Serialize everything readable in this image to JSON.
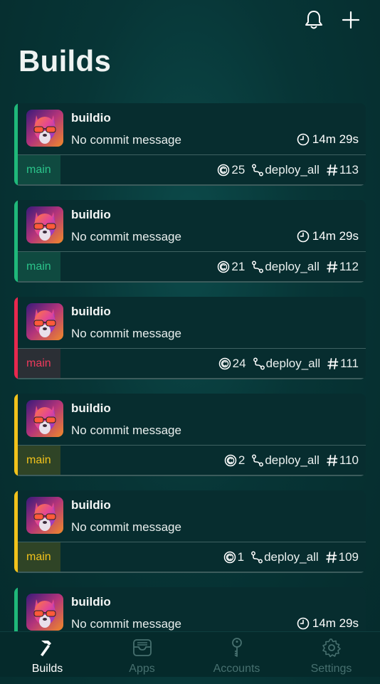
{
  "header": {
    "title": "Builds"
  },
  "builds": [
    {
      "repo": "buildio",
      "message": "No commit message",
      "duration": "14m 29s",
      "branch": "main",
      "credits": "25",
      "workflow": "deploy_all",
      "number": "113",
      "status_color": "#1fb87a",
      "branch_bg": "#0f4a40",
      "branch_color": "#2bc48a"
    },
    {
      "repo": "buildio",
      "message": "No commit message",
      "duration": "14m 29s",
      "branch": "main",
      "credits": "21",
      "workflow": "deploy_all",
      "number": "112",
      "status_color": "#1fb87a",
      "branch_bg": "#0f4a40",
      "branch_color": "#2bc48a"
    },
    {
      "repo": "buildio",
      "message": "No commit message",
      "duration": "",
      "branch": "main",
      "credits": "24",
      "workflow": "deploy_all",
      "number": "111",
      "status_color": "#e8284e",
      "branch_bg": "#2b2f35",
      "branch_color": "#ee3a5c"
    },
    {
      "repo": "buildio",
      "message": "No commit message",
      "duration": "",
      "branch": "main",
      "credits": "2",
      "workflow": "deploy_all",
      "number": "110",
      "status_color": "#f2c21b",
      "branch_bg": "#2f4426",
      "branch_color": "#f2c21b"
    },
    {
      "repo": "buildio",
      "message": "No commit message",
      "duration": "",
      "branch": "main",
      "credits": "1",
      "workflow": "deploy_all",
      "number": "109",
      "status_color": "#f2c21b",
      "branch_bg": "#2f4426",
      "branch_color": "#f2c21b"
    },
    {
      "repo": "buildio",
      "message": "No commit message",
      "duration": "14m 29s",
      "branch": "",
      "credits": "",
      "workflow": "",
      "number": "",
      "status_color": "#1fb87a",
      "branch_bg": "#0f4a40",
      "branch_color": "#2bc48a"
    }
  ],
  "tabs": [
    {
      "label": "Builds",
      "icon": "hammer-icon",
      "active": true
    },
    {
      "label": "Apps",
      "icon": "tray-icon",
      "active": false
    },
    {
      "label": "Accounts",
      "icon": "key-icon",
      "active": false
    },
    {
      "label": "Settings",
      "icon": "gear-icon",
      "active": false
    }
  ]
}
